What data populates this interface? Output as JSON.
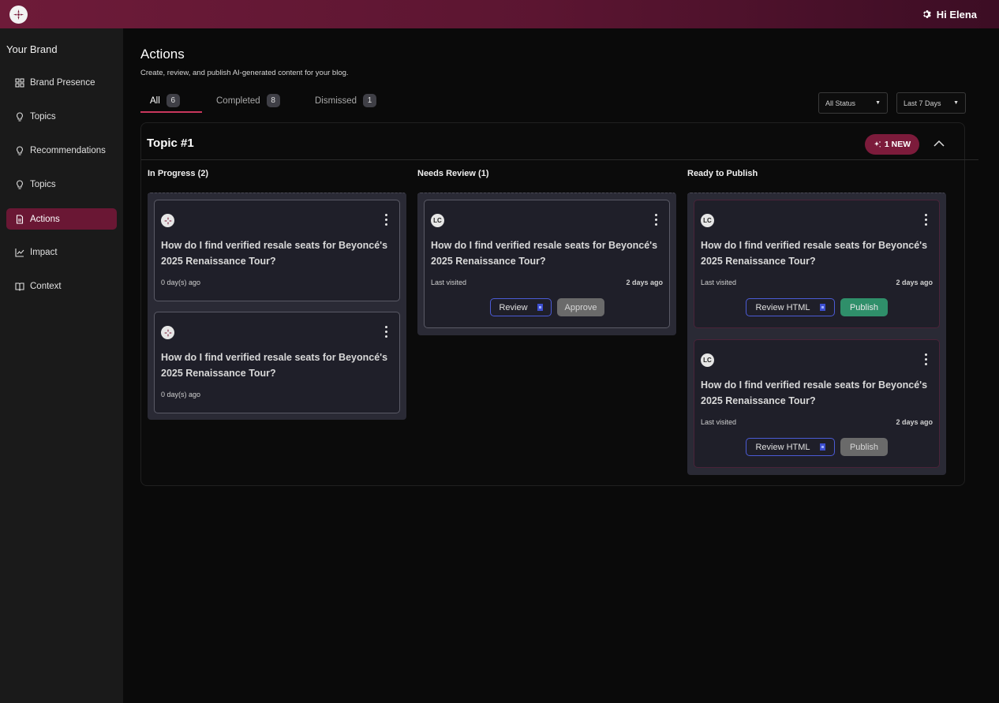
{
  "header": {
    "greeting": "Hi Elena"
  },
  "sidebar": {
    "brand": "Your Brand",
    "items": [
      {
        "label": "Brand Presence",
        "icon": "grid-icon"
      },
      {
        "label": "Topics",
        "icon": "lightbulb-icon"
      },
      {
        "label": "Recommendations",
        "icon": "lightbulb-icon"
      },
      {
        "label": "Topics",
        "icon": "lightbulb-icon"
      },
      {
        "label": "Actions",
        "icon": "document-icon",
        "active": true
      },
      {
        "label": "Impact",
        "icon": "chart-line-icon"
      },
      {
        "label": "Context",
        "icon": "book-icon"
      }
    ]
  },
  "page": {
    "title": "Actions",
    "subtitle": "Create, review, and publish AI-generated content for your blog."
  },
  "tabs": [
    {
      "label": "All",
      "count": "6",
      "active": true
    },
    {
      "label": "Completed",
      "count": "8"
    },
    {
      "label": "Dismissed",
      "count": "1"
    }
  ],
  "filters": {
    "status": "All Status",
    "range": "Last 7 Days"
  },
  "topic": {
    "title": "Topic #1",
    "new_badge": "1 NEW",
    "columns": {
      "in_progress": {
        "heading": "In Progress (2)",
        "cards": [
          {
            "question": "How do I find verified resale seats for Beyoncé's 2025 Renaissance Tour?",
            "age": "0 day(s) ago"
          },
          {
            "question": "How do I find verified resale seats for Beyoncé's 2025 Renaissance Tour?",
            "age": "0 day(s) ago"
          }
        ]
      },
      "needs_review": {
        "heading": "Needs Review (1)",
        "cards": [
          {
            "avatar": "LC",
            "question": "How do I find verified resale seats for Beyoncé's 2025 Renaissance Tour?",
            "visited_label": "Last visited",
            "visited_value": "2 days ago",
            "primary": "Review",
            "secondary": "Approve"
          }
        ]
      },
      "ready": {
        "heading": "Ready to Publish",
        "cards": [
          {
            "avatar": "LC",
            "question": "How do I find verified resale seats for Beyoncé's 2025 Renaissance Tour?",
            "visited_label": "Last visited",
            "visited_value": "2 days ago",
            "primary": "Review HTML",
            "secondary": "Publish",
            "publish_enabled": true
          },
          {
            "avatar": "LC",
            "question": "How do I find verified resale seats for Beyoncé's 2025 Renaissance Tour?",
            "visited_label": "Last visited",
            "visited_value": "2 days ago",
            "primary": "Review HTML",
            "secondary": "Publish",
            "publish_enabled": false
          }
        ]
      }
    }
  },
  "colors": {
    "accent": "#6a1734",
    "badge": "#7c1b3b",
    "publish": "#2f8f6a",
    "outline": "#4b5bd6"
  }
}
